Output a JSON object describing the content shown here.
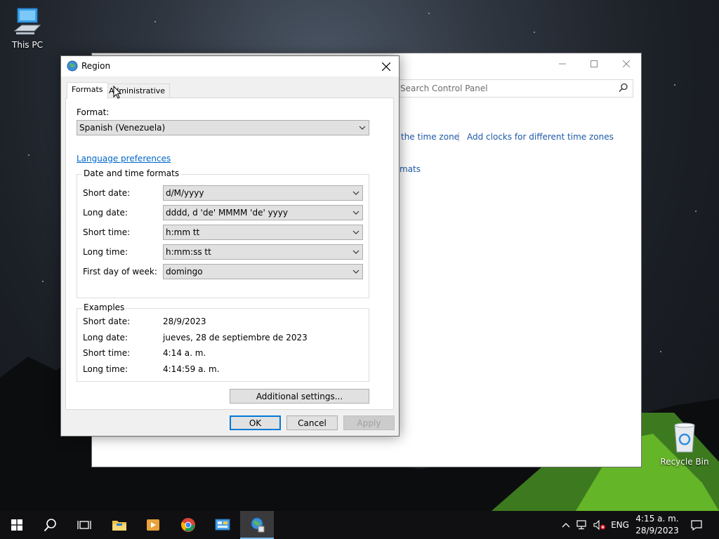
{
  "desktop": {
    "icons": [
      {
        "label": "This PC"
      },
      {
        "label": "Recycle Bin"
      }
    ]
  },
  "control_panel": {
    "search_placeholder": "Search Control Panel",
    "links": {
      "time_zone": "the time zone",
      "add_clocks": "Add clocks for different time zones",
      "formats": "mats"
    }
  },
  "dialog": {
    "title": "Region",
    "tabs": [
      {
        "label": "Formats",
        "active": true
      },
      {
        "label": "Administrative",
        "active": false
      }
    ],
    "format_label": "Format:",
    "format_value": "Spanish (Venezuela)",
    "language_preferences": "Language preferences",
    "date_time_group": {
      "title": "Date and time formats",
      "rows": [
        {
          "label": "Short date:",
          "value": "d/M/yyyy"
        },
        {
          "label": "Long date:",
          "value": "dddd, d 'de' MMMM 'de' yyyy"
        },
        {
          "label": "Short time:",
          "value": "h:mm tt"
        },
        {
          "label": "Long time:",
          "value": "h:mm:ss tt"
        },
        {
          "label": "First day of week:",
          "value": "domingo"
        }
      ]
    },
    "examples_group": {
      "title": "Examples",
      "rows": [
        {
          "label": "Short date:",
          "value": "28/9/2023"
        },
        {
          "label": "Long date:",
          "value": "jueves, 28 de septiembre de 2023"
        },
        {
          "label": "Short time:",
          "value": "4:14 a. m."
        },
        {
          "label": "Long time:",
          "value": "4:14:59 a. m."
        }
      ]
    },
    "additional_settings": "Additional settings...",
    "buttons": {
      "ok": "OK",
      "cancel": "Cancel",
      "apply": "Apply"
    }
  },
  "taskbar": {
    "language": "ENG",
    "time": "4:15 a. m.",
    "date": "28/9/2023"
  },
  "colors": {
    "accent": "#0078d7",
    "link": "#0066cc",
    "taskbar": "#101012"
  }
}
